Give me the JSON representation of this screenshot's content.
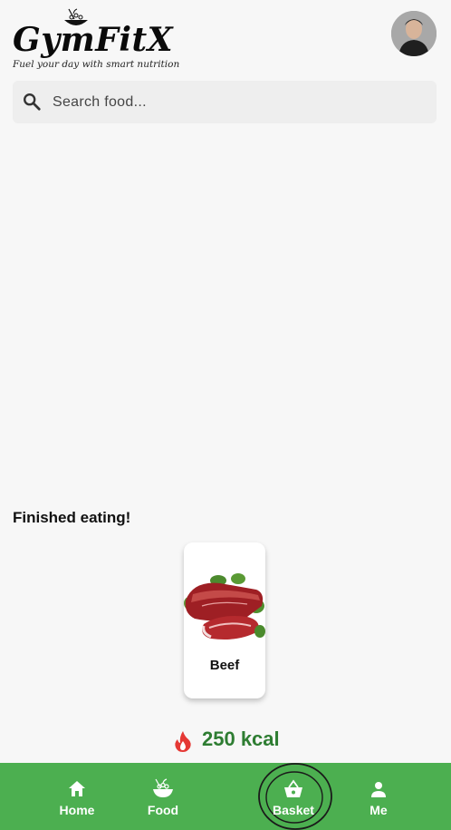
{
  "header": {
    "logo_text": "GymFitX",
    "tagline": "Fuel your day with smart nutrition"
  },
  "search": {
    "placeholder": "Search food..."
  },
  "section": {
    "title": "Finished eating!"
  },
  "food_items": [
    {
      "name": "Beef"
    }
  ],
  "summary": {
    "kcal_label": "250 kcal"
  },
  "nav": {
    "items": [
      {
        "label": "Home",
        "icon": "home-icon"
      },
      {
        "label": "Food",
        "icon": "salad-bowl-icon"
      },
      {
        "label": "Basket",
        "icon": "basket-icon",
        "selected": true
      },
      {
        "label": "Me",
        "icon": "person-icon"
      }
    ]
  },
  "colors": {
    "nav_green": "#4caf50",
    "kcal_green": "#2e7d32",
    "flame_red": "#e53935",
    "background": "#f7f7f7"
  }
}
